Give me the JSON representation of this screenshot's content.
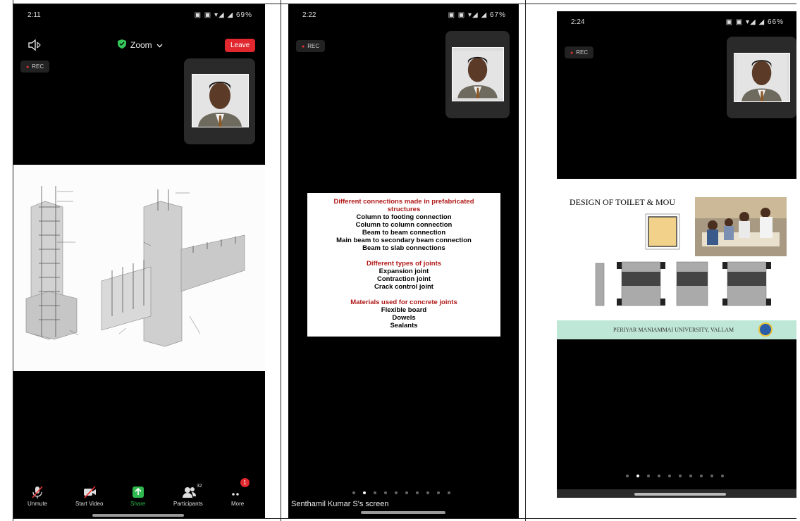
{
  "phone1": {
    "status": {
      "time": "2:11",
      "right": "▣ ▣ ▾◢ ◢ 69%"
    },
    "app_title": "Zoom",
    "leave_label": "Leave",
    "rec_label": "REC",
    "toolbar": {
      "unmute": "Unmute",
      "start_video": "Start Video",
      "share": "Share",
      "participants": "Participants",
      "participants_count": "32",
      "more": "More",
      "more_badge": "1"
    }
  },
  "phone2": {
    "status": {
      "time": "2:22",
      "right": "▣ ▣ ▾◢ ◢ 67%"
    },
    "rec_label": "REC",
    "slide": {
      "h1": "Different connections made in prefabricated structures",
      "list1": [
        "Column to footing connection",
        "Column to column connection",
        "Beam to beam connection",
        "Main beam to secondary beam connection",
        "Beam to slab connections"
      ],
      "h2": "Different types of joints",
      "list2": [
        "Expansion joint",
        "Contraction joint",
        "Crack control joint"
      ],
      "h3": "Materials used for concrete joints",
      "list3": [
        "Flexible board",
        "Dowels",
        "Sealants"
      ]
    },
    "screen_label": "Senthamil Kumar S's screen"
  },
  "phone3": {
    "status": {
      "time": "2:24",
      "right": "▣ ▣ ▾◢ ◢ 66%"
    },
    "rec_label": "REC",
    "slide_title": "DESIGN OF TOILET & MOU",
    "footer_text": "PERIYAR MANIAMMAI UNIVERSITY, VALLAM"
  },
  "colors": {
    "accent_red": "#b01818",
    "leave_red": "#e0282e",
    "share_green": "#2fb84f",
    "zoom_green": "#34c759",
    "footer_teal": "#bfe7d8"
  },
  "icons": [
    "bluetooth-speaker-icon",
    "shield-check-icon",
    "chevron-down-icon",
    "mic-muted-icon",
    "video-off-icon",
    "share-arrow-icon",
    "participants-icon",
    "more-dots-icon",
    "university-logo-icon"
  ]
}
